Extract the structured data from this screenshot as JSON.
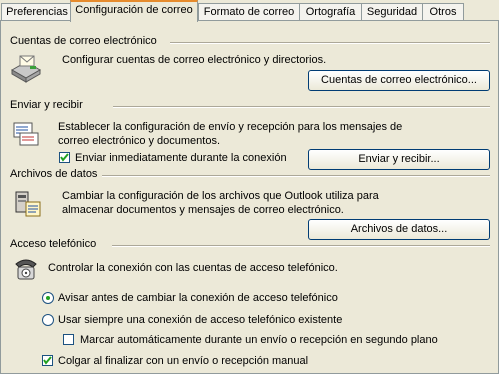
{
  "tabs": [
    {
      "label": "Preferencias"
    },
    {
      "label": "Configuración de correo"
    },
    {
      "label": "Formato de correo"
    },
    {
      "label": "Ortografía"
    },
    {
      "label": "Seguridad"
    },
    {
      "label": "Otros"
    }
  ],
  "accounts": {
    "title": "Cuentas de correo electrónico",
    "description": "Configurar cuentas de correo electrónico y directorios.",
    "button": "Cuentas de correo electrónico..."
  },
  "send_receive": {
    "title": "Enviar y recibir",
    "description": "Establecer la configuración de envío y recepción para los mensajes de correo electrónico y documentos.",
    "checkbox_label": "Enviar inmediatamente durante la conexión",
    "checkbox_checked": true,
    "button": "Enviar y recibir..."
  },
  "data_files": {
    "title": "Archivos de datos",
    "description": "Cambiar la configuración de los archivos que Outlook utiliza para almacenar documentos y mensajes de correo electrónico.",
    "button": "Archivos de datos..."
  },
  "dialup": {
    "title": "Acceso telefónico",
    "description": "Controlar la conexión con las cuentas de acceso telefónico.",
    "radio_warn": "Avisar antes de cambiar la conexión de acceso telefónico",
    "radio_always": "Usar siempre una conexión de acceso telefónico existente",
    "selected_radio": "warn",
    "auto_dial_label": "Marcar automáticamente durante un envío o recepción en segundo plano",
    "auto_dial_checked": false,
    "hangup_label": "Colgar al finalizar con un envío o recepción manual",
    "hangup_checked": true
  },
  "colors": {
    "background": "#ece9d8",
    "active_tab_accent": "#e68b2c",
    "button_border": "#003c74",
    "check_green": "#21a121"
  },
  "icons": {
    "accounts": "mail-server-icon",
    "send_receive": "send-receive-icon",
    "data_files": "data-file-icon",
    "dialup": "telephone-icon"
  }
}
